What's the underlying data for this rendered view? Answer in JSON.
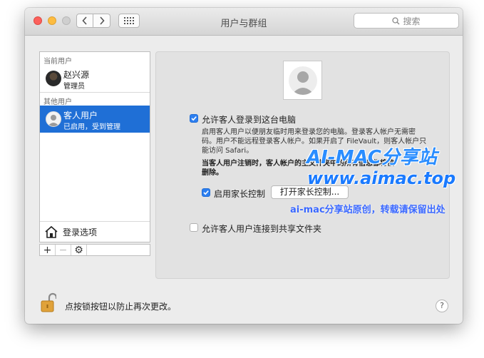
{
  "window": {
    "title": "用户与群组",
    "search_placeholder": "搜索"
  },
  "sidebar": {
    "current_users_label": "当前用户",
    "current_user": {
      "name": "赵兴源",
      "role": "管理员"
    },
    "other_users_label": "其他用户",
    "guest_user": {
      "name": "客人用户",
      "role": "已启用，受到管理"
    },
    "login_options_label": "登录选项",
    "toolbar": {
      "add": "+",
      "remove": "−",
      "settings": "⚙"
    }
  },
  "panel": {
    "allow_guest_login": {
      "label": "允许客人登录到这台电脑",
      "checked": true
    },
    "guest_desc": [
      "启用客人用户以便朋友临时用来登录您的电脑。登录客人帐户无需密",
      "码。用户不能远程登录客人帐户。如果开启了 FileVault，则客人帐户只",
      "能访问 Safari。"
    ],
    "logout_desc": [
      "当客人用户注销时，客人帐户的主文件夹中的所有信息都将被",
      "删除。"
    ],
    "parental_controls": {
      "label": "启用家长控制",
      "checked": true
    },
    "open_parental_button": "打开家长控制...",
    "allow_shared_folders": {
      "label": "允许客人用户连接到共享文件夹",
      "checked": false
    }
  },
  "footer": {
    "lock_text": "点按锁按钮以防止再次更改。",
    "help": "?"
  },
  "watermark": {
    "line1": "AI-MAC分享站",
    "line2": "www.aimac.top",
    "line3": "ai-mac分享站原创，转载请保留出处"
  },
  "colors": {
    "selection": "#1f6fd6",
    "checkbox_on": "#2d7ff0",
    "watermark": "#2a8dff"
  }
}
